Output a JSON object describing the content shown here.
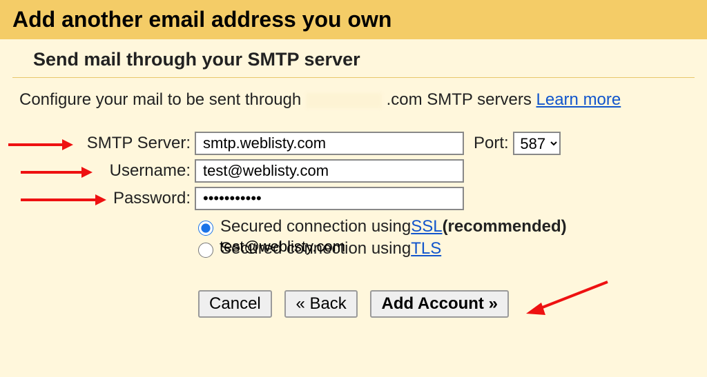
{
  "header": {
    "title": "Add another email address you own"
  },
  "subheader": "Send mail through your SMTP server",
  "desc": {
    "prefix": "Configure your mail to be sent through ",
    "suffix": ".com SMTP servers ",
    "learn": "Learn more"
  },
  "form": {
    "smtp_label": "SMTP Server:",
    "smtp_value": "smtp.weblisty.com",
    "port_label": "Port:",
    "port_value": "587",
    "user_label": "Username:",
    "user_value": "test@weblisty.com",
    "pass_label": "Password:",
    "pass_value": "•••••••••••"
  },
  "radios": {
    "ssl_pre": "Secured connection using ",
    "ssl_link": "SSL",
    "ssl_post": " (recommended)",
    "tls_pre": "Secured connection using ",
    "tls_link": "TLS",
    "stray_text": "test@weblisty.com"
  },
  "buttons": {
    "cancel": "Cancel",
    "back": "« Back",
    "add": "Add Account »"
  }
}
